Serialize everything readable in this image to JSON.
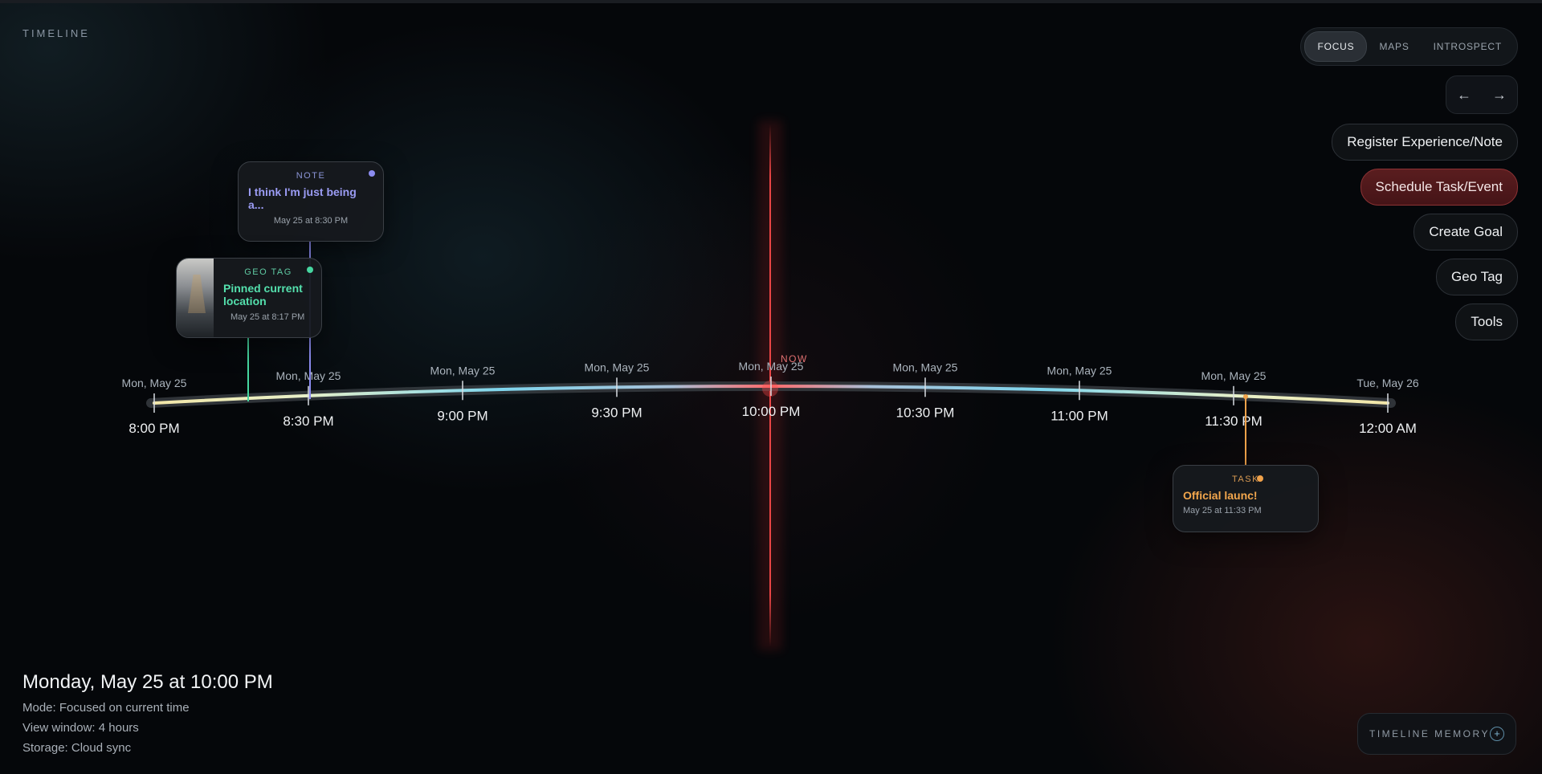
{
  "app": {
    "title": "TIMELINE"
  },
  "modes": [
    {
      "label": "FOCUS",
      "active": true
    },
    {
      "label": "MAPS",
      "active": false
    },
    {
      "label": "INTROSPECT",
      "active": false
    }
  ],
  "nav": {
    "prev": "←",
    "next": "→"
  },
  "actions": [
    {
      "label": "Register Experience/Note",
      "primary": false
    },
    {
      "label": "Schedule Task/Event",
      "primary": true
    },
    {
      "label": "Create Goal",
      "primary": false
    },
    {
      "label": "Geo Tag",
      "primary": false
    },
    {
      "label": "Tools",
      "primary": false
    }
  ],
  "timeline": {
    "now_label": "NOW",
    "ticks": [
      {
        "date": "Mon, May 25",
        "time": "8:00 PM"
      },
      {
        "date": "Mon, May 25",
        "time": "8:30 PM"
      },
      {
        "date": "Mon, May 25",
        "time": "9:00 PM"
      },
      {
        "date": "Mon, May 25",
        "time": "9:30 PM"
      },
      {
        "date": "Mon, May 25",
        "time": "10:00 PM"
      },
      {
        "date": "Mon, May 25",
        "time": "10:30 PM"
      },
      {
        "date": "Mon, May 25",
        "time": "11:00 PM"
      },
      {
        "date": "Mon, May 25",
        "time": "11:30 PM"
      },
      {
        "date": "Tue, May 26",
        "time": "12:00 AM"
      }
    ]
  },
  "events": {
    "note": {
      "kind": "NOTE",
      "title": "I think I'm just being a...",
      "time": "May 25 at 8:30 PM",
      "color": "#8c8cf0"
    },
    "geotag": {
      "kind": "GEO TAG",
      "title": "Pinned current location",
      "time": "May 25 at 8:17 PM",
      "color": "#46d6a0"
    },
    "task": {
      "kind": "TASK",
      "title": "Official launc!",
      "time": "May 25 at 11:33 PM",
      "color": "#f0a24a"
    }
  },
  "status": {
    "heading": "Monday, May 25 at 10:00 PM",
    "mode": "Mode: Focused on current time",
    "window": "View window: 4 hours",
    "storage": "Storage: Cloud sync"
  },
  "memory": {
    "label": "TIMELINE MEMORY",
    "plus": "+"
  },
  "colors": {
    "now": "#ff4b4b",
    "track_cool": "#7fd6ee",
    "track_warm": "#f2e6a8"
  }
}
